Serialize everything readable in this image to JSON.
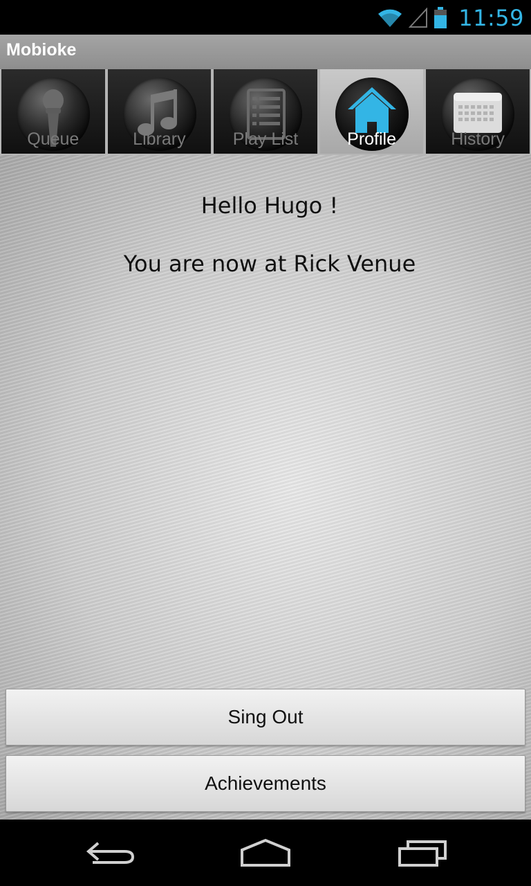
{
  "status_bar": {
    "time": "11:59"
  },
  "action_bar": {
    "title": "Mobioke"
  },
  "tabs": [
    {
      "label": "Queue",
      "icon": "microphone-icon",
      "selected": false
    },
    {
      "label": "Library",
      "icon": "music-note-icon",
      "selected": false
    },
    {
      "label": "Play List",
      "icon": "list-icon",
      "selected": false
    },
    {
      "label": "Profile",
      "icon": "home-icon",
      "selected": true
    },
    {
      "label": "History",
      "icon": "calendar-icon",
      "selected": false
    }
  ],
  "content": {
    "greeting": "Hello Hugo !",
    "venue": "You are now at Rick Venue"
  },
  "buttons": {
    "sing_out": "Sing Out",
    "achievements": "Achievements"
  },
  "colors": {
    "accent": "#33b5e5",
    "action_bar": "#9a9a9a"
  }
}
